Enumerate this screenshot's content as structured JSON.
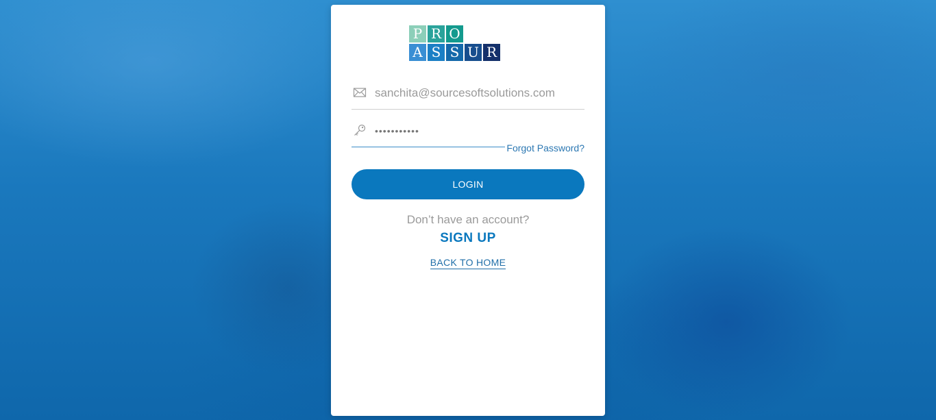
{
  "brand": {
    "logo_row1": [
      "P",
      "R",
      "O"
    ],
    "logo_row2": [
      "A",
      "S",
      "S",
      "U",
      "R"
    ],
    "logo_row1_colors": [
      "#8ccfb9",
      "#2aa39b",
      "#139a8e"
    ],
    "logo_row2_colors": [
      "#3a8fd4",
      "#1b7fc5",
      "#1469aa",
      "#174e8e",
      "#14306b"
    ]
  },
  "login_form": {
    "email_icon": "envelope-icon",
    "email_value": "sanchita@sourcesoftsolutions.com",
    "password_icon": "key-icon",
    "password_value": "•••••••••••",
    "forgot_password_label": "Forgot Password?",
    "login_label": "LOGIN"
  },
  "signup": {
    "prompt": "Don’t have an account?",
    "label": "SIGN UP"
  },
  "back_home_label": "BACK TO HOME",
  "colors": {
    "primary": "#0a78be",
    "background": "#1a78bd"
  }
}
